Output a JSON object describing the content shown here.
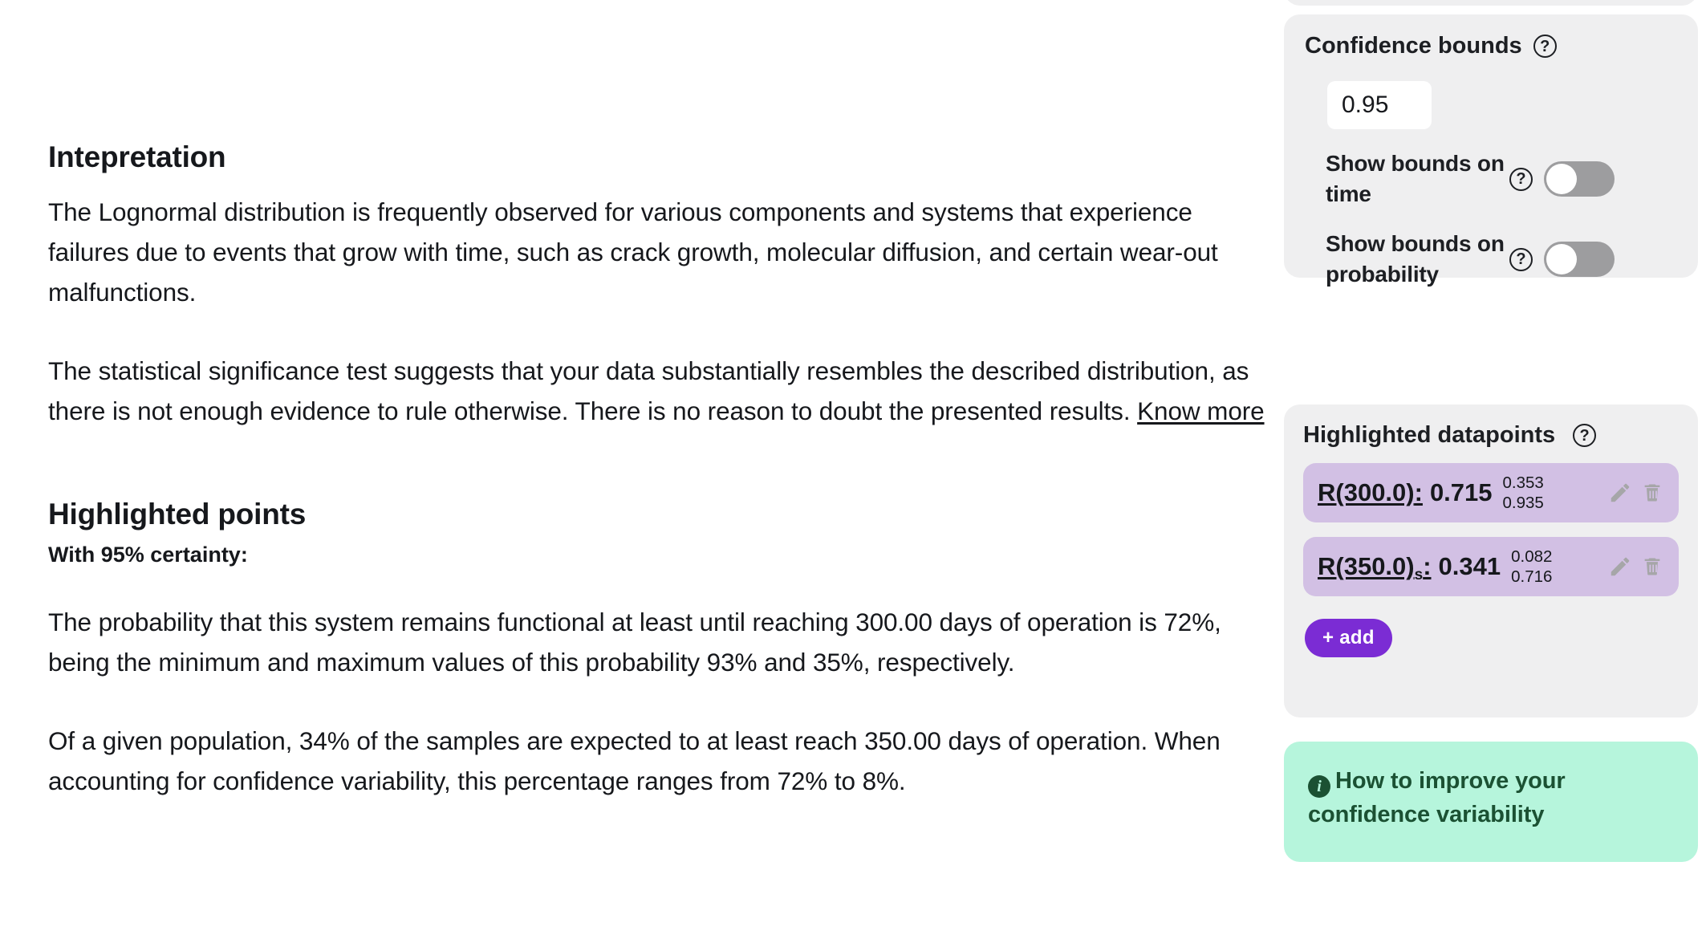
{
  "interpretation": {
    "title": "Intepretation",
    "paragraph_1": "The Lognormal distribution is frequently observed for various components and systems that experience failures due to events that grow with time, such as crack growth, molecular diffusion, and certain wear-out malfunctions.",
    "paragraph_2_before_link": "The statistical significance test suggests that your data substantially resembles the described distribution, as there is not enough evidence to rule otherwise. There is no reason to doubt the presented results. ",
    "know_more_link": "Know more"
  },
  "highlighted_points": {
    "title": "Highlighted points",
    "certainty_line": "With 95% certainty:",
    "paragraph_1": "The probability that this system remains functional at least until reaching 300.00 days of operation is 72%, being the minimum and maximum values of this probability 93% and 35%, respectively.",
    "paragraph_2": "Of a given population, 34% of the samples are expected to at least reach 350.00 days of operation. When accounting for confidence variability, this percentage ranges from 72% to 8%."
  },
  "confidence_bounds": {
    "title": "Confidence bounds",
    "help_glyph": "?",
    "value": "0.95",
    "toggles": [
      {
        "label": "Show bounds on time",
        "state": "off",
        "help_glyph": "?"
      },
      {
        "label": "Show bounds on probability",
        "state": "off",
        "help_glyph": "?"
      }
    ]
  },
  "highlighted_datapoints": {
    "title": "Highlighted datapoints",
    "help_glyph": "?",
    "rows": [
      {
        "label": "R(300.0):",
        "label_base": "R(300.0)",
        "subscript": "",
        "value": "0.715",
        "lower_bound": "0.353",
        "upper_bound": "0.935",
        "edit_icon": "pencil-icon",
        "delete_icon": "trash-icon"
      },
      {
        "label": "R(350.0)s:",
        "label_base": "R(350.0)",
        "subscript": "s",
        "value": "0.341",
        "lower_bound": "0.082",
        "upper_bound": "0.716",
        "edit_icon": "pencil-icon",
        "delete_icon": "trash-icon"
      }
    ],
    "add_button_label": "+ add"
  },
  "improve_card": {
    "info_glyph": "i",
    "text": "How to improve your confidence variability"
  },
  "colors": {
    "accent_purple": "#7b2cd4",
    "datapoint_row": "#d2c0e4",
    "panel_gray": "#efeff0",
    "tip_green_bg": "#b6f5dc",
    "tip_green_text": "#1b5133",
    "toggle_track_off": "#9d9d9f",
    "text_primary": "#16181c"
  }
}
